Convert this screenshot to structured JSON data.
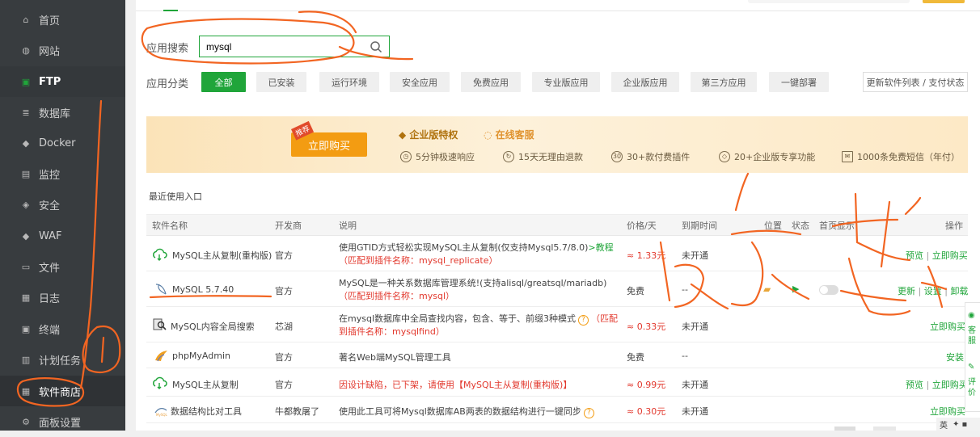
{
  "sidebar": {
    "items": [
      {
        "label": "首页",
        "icon": "home-icon"
      },
      {
        "label": "网站",
        "icon": "globe-icon"
      },
      {
        "label": "FTP",
        "icon": "ftp-icon"
      },
      {
        "label": "数据库",
        "icon": "database-icon"
      },
      {
        "label": "Docker",
        "icon": "docker-icon"
      },
      {
        "label": "监控",
        "icon": "monitor-icon"
      },
      {
        "label": "安全",
        "icon": "shield-icon"
      },
      {
        "label": "WAF",
        "icon": "waf-icon"
      },
      {
        "label": "文件",
        "icon": "folder-icon"
      },
      {
        "label": "日志",
        "icon": "log-icon"
      },
      {
        "label": "终端",
        "icon": "terminal-icon"
      },
      {
        "label": "计划任务",
        "icon": "clock-icon"
      },
      {
        "label": "软件商店",
        "icon": "store-icon"
      },
      {
        "label": "面板设置",
        "icon": "settings-icon"
      }
    ]
  },
  "search": {
    "label": "应用搜索",
    "value": "mysql"
  },
  "categories": {
    "label": "应用分类",
    "items": [
      "全部",
      "已安装",
      "运行环境",
      "安全应用",
      "免费应用",
      "专业版应用",
      "企业版应用",
      "第三方应用",
      "一键部署"
    ],
    "update_button": "更新软件列表 / 支付状态"
  },
  "banner": {
    "tag": "推荐",
    "buy_label": "立即购买",
    "vip_title": "企业版特权",
    "service": "在线客服",
    "features": [
      "5分钟极速响应",
      "15天无理由退款",
      "30+款付费插件",
      "20+企业版专享功能",
      "1000条免费短信（年付）"
    ]
  },
  "recent_label": "最近使用入口",
  "table": {
    "headers": [
      "软件名称",
      "开发商",
      "说明",
      "价格/天",
      "到期时间",
      "位置",
      "状态",
      "首页显示",
      "操作"
    ],
    "rows": [
      {
        "name": "MySQL主从复制(重构版)",
        "vendor": "官方",
        "desc_main": "使用GTID方式轻松实现MySQL主从复制(仅支持Mysql5.7/8.0)",
        "desc_link": ">教程",
        "desc_extra": "（匹配到插件名称：mysql_replicate）",
        "price": "≈ 1.33元",
        "expire": "未开通",
        "actions": [
          "预览",
          "立即购买"
        ]
      },
      {
        "name": "MySQL 5.7.40",
        "vendor": "官方",
        "desc_main": "MySQL是一种关系数据库管理系统!(支持alisql/greatsql/mariadb)",
        "desc_extra": "（匹配到插件名称：mysql）",
        "price": "免费",
        "expire": "--",
        "actions": [
          "更新",
          "设置",
          "卸载"
        ]
      },
      {
        "name": "MySQL内容全局搜索",
        "vendor": "芯湖",
        "desc_main": "在mysql数据库中全局查找内容，包含、等于、前缀3种模式",
        "desc_extra": "（匹配到插件名称：mysqlfind）",
        "price": "≈ 0.33元",
        "expire": "未开通",
        "actions": [
          "立即购买"
        ]
      },
      {
        "name": "phpMyAdmin",
        "vendor": "官方",
        "desc_main": "著名Web端MySQL管理工具",
        "price": "免费",
        "expire": "--",
        "actions": [
          "安装"
        ]
      },
      {
        "name": "MySQL主从复制",
        "vendor": "官方",
        "desc_main": "因设计缺陷，已下架，请使用【MySQL主从复制(重构版)】",
        "price": "≈ 0.99元",
        "expire": "未开通",
        "actions": [
          "预览",
          "立即购买"
        ]
      },
      {
        "name": "数据结构比对工具",
        "vendor": "牛都教屠了",
        "desc_main": "使用此工具可将Mysql数据库AB两表的数据结构进行一键同步",
        "price": "≈ 0.30元",
        "expire": "未开通",
        "actions": [
          "立即购买"
        ]
      }
    ]
  },
  "side_widget": {
    "service": "客服",
    "feedback": "评价"
  },
  "ime": "英",
  "colors": {
    "accent": "#20a53a",
    "sidebar": "#383c3f",
    "orange": "#f39c12",
    "annotation": "#f26522"
  }
}
